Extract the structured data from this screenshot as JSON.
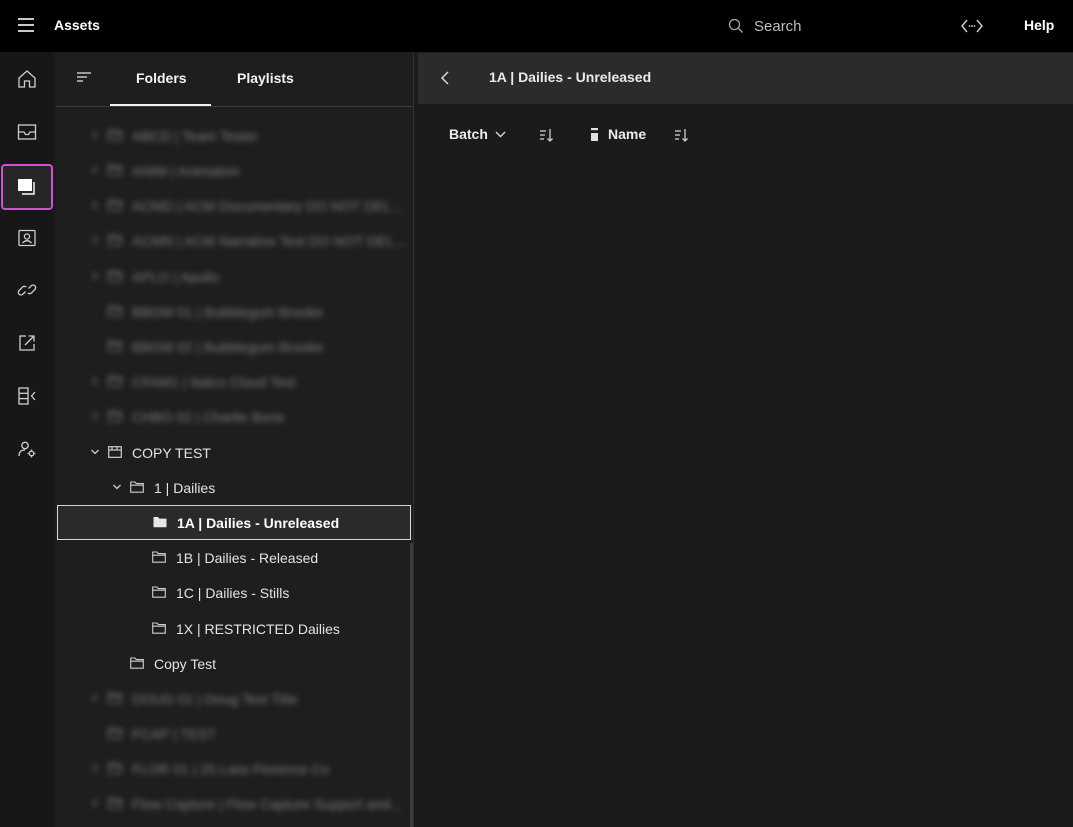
{
  "header": {
    "app_title": "Assets",
    "search_placeholder": "Search",
    "help_label": "Help"
  },
  "rail": {
    "items": [
      {
        "icon": "home-icon"
      },
      {
        "icon": "inbox-icon"
      },
      {
        "icon": "assets-icon",
        "active": true
      },
      {
        "icon": "contact-card-icon"
      },
      {
        "icon": "link-icon"
      },
      {
        "icon": "share-icon"
      },
      {
        "icon": "layout-panel-icon"
      },
      {
        "icon": "user-settings-icon"
      }
    ],
    "active_color": "#d34fd6"
  },
  "panel": {
    "tabs": {
      "folders": "Folders",
      "playlists": "Playlists",
      "active": "Folders"
    },
    "tree": [
      {
        "label": "ABCD | Team Tester",
        "blurred": true
      },
      {
        "label": "ANIM | Animation",
        "blurred": true
      },
      {
        "label": "ACMD | ACM Documentary DO NOT DEL...",
        "blurred": true
      },
      {
        "label": "ACMN | ACM Narrative Test DO NOT DEL...",
        "blurred": true
      },
      {
        "label": "APLO | Apollo",
        "blurred": true
      },
      {
        "label": "BBGM 01 | Bubblegum Brooke",
        "blurred": true
      },
      {
        "label": "BBGM 02 | Bubblegum Brooke",
        "blurred": true
      },
      {
        "label": "CFAM1 | Italics Cloud Test",
        "blurred": true
      },
      {
        "label": "CHBO 02 | Charlie Bone",
        "blurred": true
      },
      {
        "label": "COPY TEST",
        "blurred": false,
        "expanded": true
      },
      {
        "label": "1 | Dailies",
        "blurred": false,
        "expanded": true
      },
      {
        "label": "1A | Dailies - Unreleased",
        "blurred": false,
        "selected": true
      },
      {
        "label": "1B | Dailies - Released",
        "blurred": false
      },
      {
        "label": "1C | Dailies - Stills",
        "blurred": false
      },
      {
        "label": "1X | RESTRICTED Dailies",
        "blurred": false
      },
      {
        "label": "Copy Test",
        "blurred": false
      },
      {
        "label": "DOUG 01 | Doug Test Title",
        "blurred": true
      },
      {
        "label": "FCAP | TEST",
        "blurred": true
      },
      {
        "label": "FLOR 01 | 25 Lass Florence Co",
        "blurred": true
      },
      {
        "label": "Flow Capture | Flow Capture Support and...",
        "blurred": true
      }
    ]
  },
  "main": {
    "title": "1A | Dailies - Unreleased",
    "toolbar": {
      "batch_label": "Batch",
      "sort_label": "Name"
    }
  }
}
